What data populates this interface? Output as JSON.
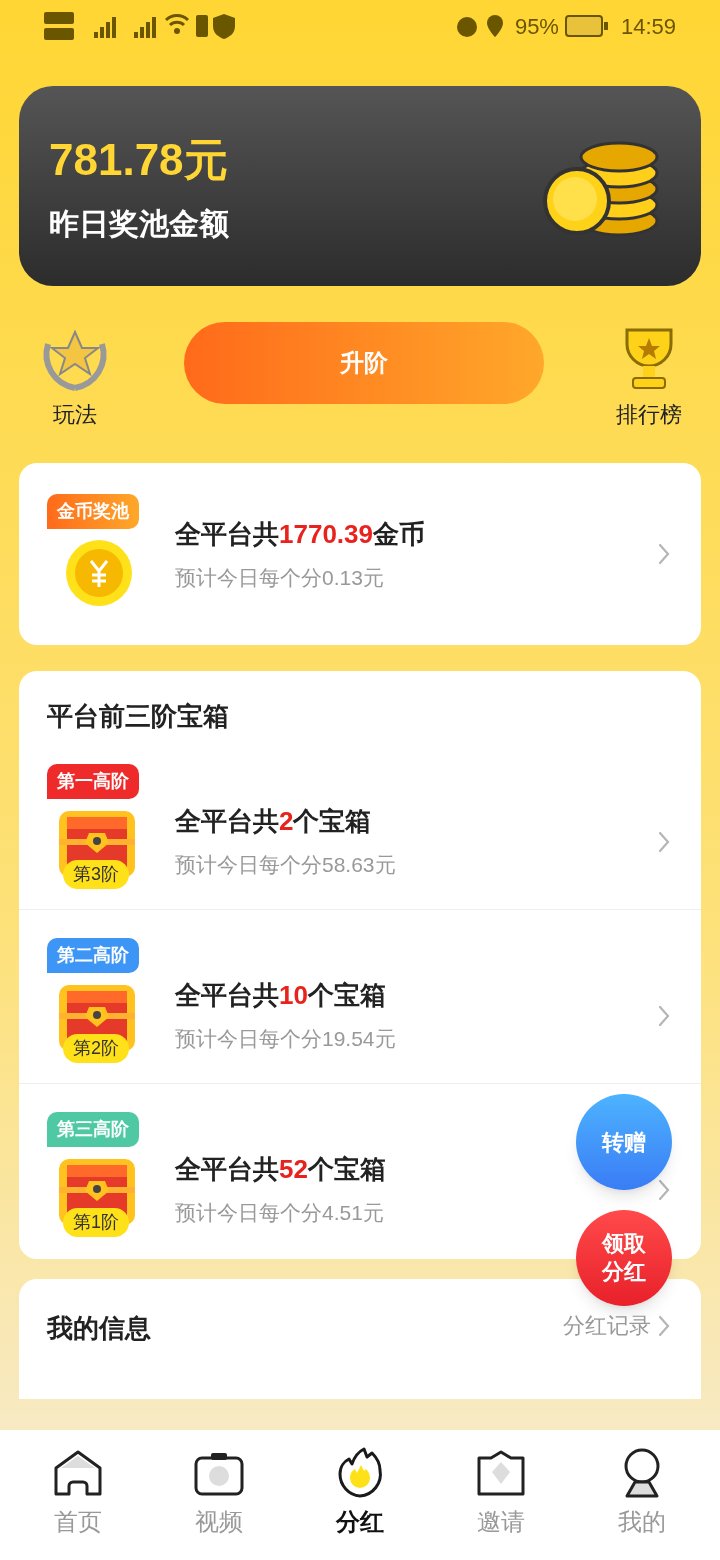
{
  "status_bar": {
    "battery": "95%",
    "time": "14:59"
  },
  "pool": {
    "amount": "781.78元",
    "label": "昨日奖池金额"
  },
  "actions": {
    "left": "玩法",
    "upgrade": "升阶",
    "right": "排行榜"
  },
  "coin_pool": {
    "tag": "金币奖池",
    "text_before": "全平台共",
    "count": "1770.39",
    "text_after": "金币",
    "estimate": "预计今日每个分0.13元"
  },
  "chests": {
    "title": "平台前三阶宝箱",
    "rows": [
      {
        "tag": "第一高阶",
        "color": "#ee2a2a",
        "level": "第3阶",
        "text_before": "全平台共",
        "count": "2",
        "text_after": "个宝箱",
        "estimate": "预计今日每个分58.63元"
      },
      {
        "tag": "第二高阶",
        "color": "#3d95f5",
        "level": "第2阶",
        "text_before": "全平台共",
        "count": "10",
        "text_after": "个宝箱",
        "estimate": "预计今日每个分19.54元"
      },
      {
        "tag": "第三高阶",
        "color": "#4fc9a4",
        "level": "第1阶",
        "text_before": "全平台共",
        "count": "52",
        "text_after": "个宝箱",
        "estimate": "预计今日每个分4.51元"
      }
    ]
  },
  "floating": {
    "transfer": "转赠",
    "claim_line1": "领取",
    "claim_line2": "分红"
  },
  "my_info": {
    "title": "我的信息",
    "link": "分红记录"
  },
  "tabs": [
    {
      "label": "首页",
      "kind": "home",
      "selected": false
    },
    {
      "label": "视频",
      "kind": "video",
      "selected": false
    },
    {
      "label": "分红",
      "kind": "bonus",
      "selected": true
    },
    {
      "label": "邀请",
      "kind": "invite",
      "selected": false
    },
    {
      "label": "我的",
      "kind": "me",
      "selected": false
    }
  ]
}
